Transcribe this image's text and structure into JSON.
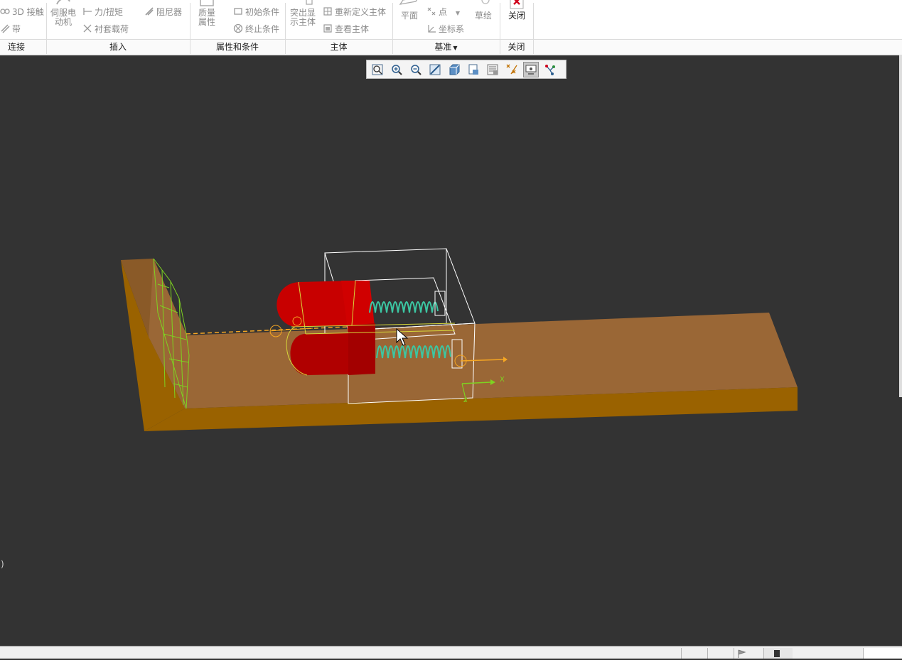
{
  "ribbon": {
    "groups": [
      {
        "label": "连接"
      },
      {
        "label": "插入"
      },
      {
        "label": "属性和条件"
      },
      {
        "label": "主体"
      },
      {
        "label": "基准"
      },
      {
        "label": "关闭"
      }
    ],
    "connect": {
      "contact_3d": "3D 接触",
      "belt": "带"
    },
    "insert": {
      "servo_motor": "伺服电动机",
      "force_torque": "力/扭矩",
      "damper": "阻尼器",
      "bushing_load": "衬套载荷"
    },
    "properties": {
      "mass_props": "质量属性",
      "initial_cond": "初始条件",
      "termination_cond": "终止条件"
    },
    "body": {
      "highlight_bodies": "突出显示主体",
      "redefine_bodies": "重新定义主体",
      "view_bodies": "查看主体"
    },
    "datum": {
      "plane": "平面",
      "point": "点",
      "csys": "坐标系",
      "sketch": "草绘"
    },
    "close": {
      "close_label": "关闭"
    }
  },
  "view_toolbar": {
    "tools": [
      {
        "icon": "refit-icon"
      },
      {
        "icon": "zoom-in-icon"
      },
      {
        "icon": "zoom-out-icon"
      },
      {
        "icon": "repaint-icon"
      },
      {
        "icon": "display-style-icon"
      },
      {
        "icon": "saved-views-icon"
      },
      {
        "icon": "view-manager-icon"
      },
      {
        "icon": "datum-display-icon"
      },
      {
        "icon": "mechanism-display-icon",
        "active": true
      },
      {
        "icon": "connections-icon"
      }
    ]
  },
  "viewport": {
    "axis_x": "X",
    "axis_z": "Z",
    "left_fragment": ")",
    "colors": {
      "background": "#333333",
      "base_top": "#9a6736",
      "base_front": "#9a6200",
      "block_red": "#c80000",
      "spring": "#3cc7a3",
      "wire_green": "#7ed321",
      "wire_white": "#ffffff",
      "wire_orange": "#f5a623"
    }
  }
}
